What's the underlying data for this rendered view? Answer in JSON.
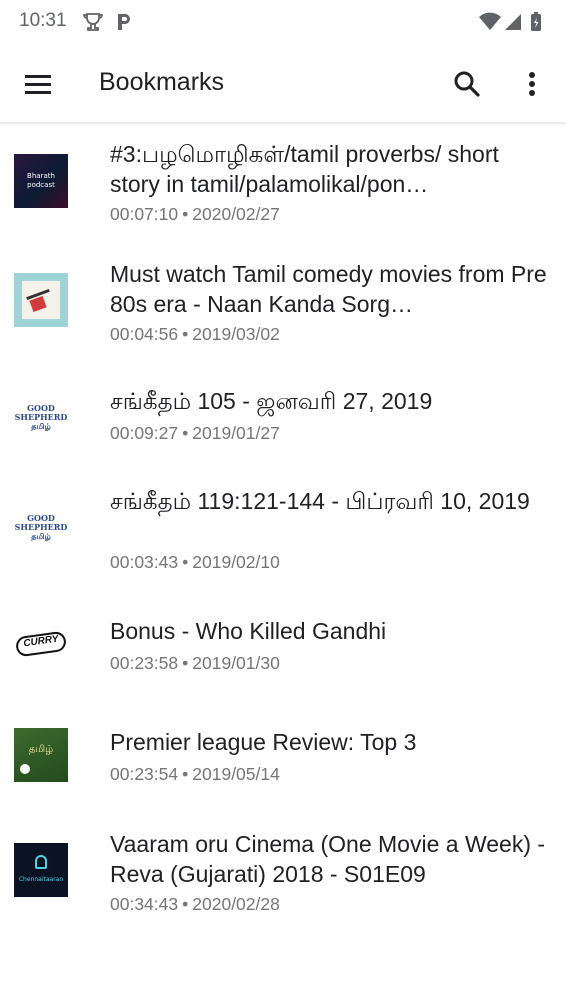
{
  "status_bar": {
    "time": "10:31"
  },
  "app_bar": {
    "title": "Bookmarks",
    "icons": {
      "menu": "hamburger-icon",
      "search": "search-icon",
      "more": "more-vert-icon"
    }
  },
  "bookmarks": [
    {
      "title": "#3:பழமொழிகள்/tamil proverbs/ short story in tamil/palamolikal/pon…",
      "duration": "00:07:10",
      "date": "2020/02/27",
      "thumb_text": "Bharath podcast"
    },
    {
      "title": "Must watch Tamil comedy movies from Pre 80s era - Naan Kanda Sorg…",
      "duration": "00:04:56",
      "date": "2019/03/02",
      "thumb_text": ""
    },
    {
      "title": "சங்கீதம் 105 - ஜனவரி 27, 2019",
      "duration": "00:09:27",
      "date": "2019/01/27",
      "thumb_text": "GOOD SHEPHERD தமிழ்"
    },
    {
      "title": "சங்கீதம் 119:121-144 - பிப்ரவரி 10, 2019",
      "duration": "00:03:43",
      "date": "2019/02/10",
      "thumb_text": "GOOD SHEPHERD தமிழ்"
    },
    {
      "title": "Bonus - Who Killed Gandhi",
      "duration": "00:23:58",
      "date": "2019/01/30",
      "thumb_text": "CURRY"
    },
    {
      "title": "Premier league Review: Top 3",
      "duration": "00:23:54",
      "date": "2019/05/14",
      "thumb_text": "தமிழ்"
    },
    {
      "title": "Vaaram oru Cinema (One Movie a Week) - Reva (Gujarati) 2018 - S01E09",
      "duration": "00:34:43",
      "date": "2020/02/28",
      "thumb_text": "Chennaitaaran"
    }
  ],
  "separator": "•"
}
